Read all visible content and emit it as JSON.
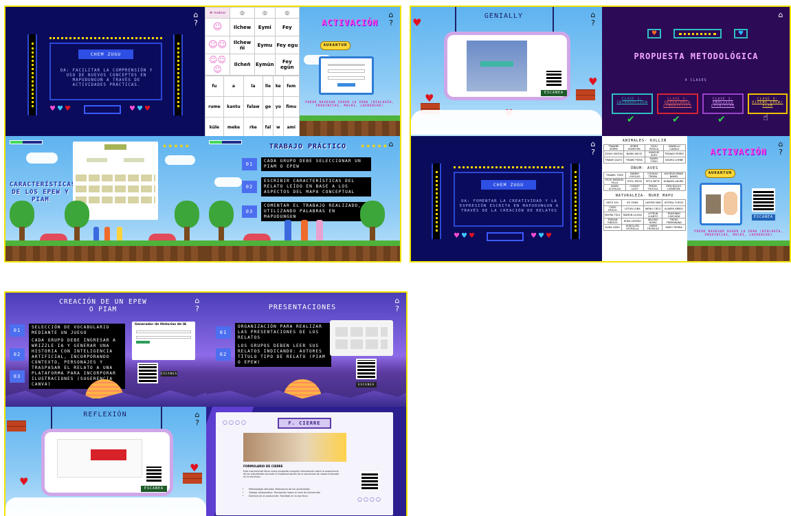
{
  "nav": {
    "home": "⌂",
    "help": "?"
  },
  "g1": {
    "s1": {
      "title": "CHEM ZUGU",
      "text": "OA: FACILITAR LA COMPRENSIÓN Y USO DE NUEVOS CONCEPTOS EN MAPUDUNGUN A TRAVÉS DE ACTIVIDADES PRÁCTICAS."
    },
    "s2": {
      "head": [
        "Ilchew",
        "Eymi",
        "Fey"
      ],
      "rows": [
        [
          "Ilchew",
          "Eymi",
          "Fey"
        ],
        [
          "Ilchew ñi",
          "Eymu",
          "Fey egu"
        ],
        [
          "Ilcheñ",
          "Eymün",
          "Fey egün"
        ]
      ],
      "words": [
        [
          "fu",
          "a",
          "la",
          "lle",
          "ke",
          "fem"
        ],
        [
          "rume",
          "kantu",
          "falaw",
          "ge",
          "yo",
          "fimu"
        ],
        [
          "küle",
          "meke",
          "rke",
          "fal",
          "w",
          "ami"
        ]
      ]
    },
    "s3": {
      "title": "ACTIVACIÓN",
      "button": "AUKANTUN",
      "caption": "PUEDE NAVEGAR SEGÚN LA ZONA (BIOLOGÍA, PROVINCIAS, MACHI, LAVDENCHE)"
    },
    "s4": {
      "title": "CARACTERÍSTICAS DE LOS EPEW Y PIAM"
    },
    "s5": {
      "title": "TRABAJO PRÁCTICO",
      "steps": [
        {
          "num": "01",
          "text": "CADA GRUPO DEBE SELECCIONAR UN PIAM O EPEW"
        },
        {
          "num": "02",
          "text": "ESCRIBIR CARACTERÍSTICAS DEL RELATO LEÍDO EN BASE A LOS ASPECTOS DEL MAPA CONCEPTUAL"
        },
        {
          "num": "03",
          "text": "COMENTAR EL TRABAJO REALIZADO, UTILIZANDO PALABRAS EN MAPUDUNGUN"
        }
      ]
    }
  },
  "g2": {
    "s1": {
      "title": "GENIALLY",
      "scan": "ESCANEA"
    },
    "s2": {
      "title": "PROPUESTA METODOLÓGICA",
      "sub": "4 CLASES",
      "classes": [
        {
          "label": "CLASE 1: INTRODUCCIÓN",
          "color": "#26c0c0"
        },
        {
          "label": "CLASE 2: REPERTORIO LINGÜÍSTICO",
          "color": "#d92332"
        },
        {
          "label": "CLASE 3: ANÁLISIS EPEW/PIAM",
          "color": "#9a43c9"
        },
        {
          "label": "CLASE 4: DISEÑO EPEW/ PIAM",
          "color": "#f2c200"
        }
      ]
    },
    "s3": {
      "sections": [
        {
          "title": "ANIMALES- KULLIÑ",
          "rows": [
            [
              "TRAWRE ZERRE",
              "ZERRE KÜMEYEN",
              "YÜGÜ PIRÜCA",
              "KAWELLU CANELU"
            ],
            [
              "ZOWO MATUN",
              "ÑARKI WECE",
              "KANCHE ZUEY",
              "TRÜNAE PERRO"
            ],
            [
              "TRAWE SALTO",
              "TRAWE PÜMA",
              "KAWEL TODO",
              "NGURU LEMBE"
            ]
          ]
        },
        {
          "title": "ÜÑUM- AVES",
          "rows": [
            [
              "TRAWEL TÜKE",
              "ÑAMKO CHUCAO",
              "CHUKAO TRAMA",
              "KULTRUN PAWA ÑAKIÑ"
            ],
            [
              "PICHI WIÑÜKEL PILLU",
              "PÜTU IPÜCE",
              "PETU ÑETE",
              "KONKEÑ LIKÜRE"
            ],
            [
              "KAKIN UCHULKA",
              "CHÜKEY LUSO",
              "PIMUN THOOLA",
              "ZEW NGULO CAÑIÑTAN"
            ]
          ]
        },
        {
          "title": "NATURALEZA- ÑUKE MAPU",
          "rows": [
            [
              "ANTÜ SOL",
              "KÜ YEWA",
              "LAFKEN MAR",
              "KÜTRAL FUEGO"
            ],
            [
              "CÜRÜ FRÜGO",
              "LÜTUN LÜNA",
              "WENU CIELO",
              "ALIWEN ÁRBOL"
            ],
            [
              "MATRA TÜLE",
              "ÑAMÜN LLUVIA",
              "LÜTRUN LLANTO",
              "TRAYÜNKO CASCADA"
            ],
            [
              "TREKAN RIÑÜGÜ",
              "RÜKA LEFEÑO",
              "WILÜMU RÜMÜ",
              "TREKO TRIMEWANA"
            ],
            [
              "KURA LÜMU",
              "KÜRÜLLEÑ ESTRELLA",
              "LIWEN TROMÜLE",
              "MAPU TIERRA"
            ]
          ]
        }
      ]
    },
    "s4": {
      "title": "CHEM ZUGU",
      "text": "OA: FOMENTAR LA CREATIVIDAD Y LA EXPRESIÓN ESCRITA EN MAPUDUNGUN A TRAVÉS DE LA CREACIÓN DE RELATOS"
    },
    "s5": {
      "title": "ACTIVACIÓN",
      "button": "AUKANTUN",
      "scan": "ESCANEA",
      "caption": "PUEDE NAVEGAR SEGÚN LA ZONA (BIOLOGÍA, PROVINCIAS, MACHI, LAVDENCHE)"
    }
  },
  "g3": {
    "s1": {
      "title": "CREACIÓN DE UN EPEW O PIAM",
      "app": "Generador de Historias de IA",
      "scan": "ESCANEA",
      "steps": [
        {
          "num": "01",
          "text": "SELECCIÓN DE VOCABULARIO MEDIANTE UN JUEGO"
        },
        {
          "num": "02",
          "text": "CADA GRUPO DEBE INGRESAR A WRIZZLE IA Y GENERAR UNA HISTORIA CON INTELIGENCIA ARTIFICIAL, INCORPORANDO CONTEXTO, PERSONAJES Y PALABRAS EN MAPUDUNGUN"
        },
        {
          "num": "03",
          "text": "TRASPASAR EL RELATO A UNA PLATAFORMA PARA INCORPORAR ILUSTRACIONES (SUGERENCIA CANVA)"
        }
      ]
    },
    "s2": {
      "title": "PRESENTACIONES",
      "scan": "ESCANEA",
      "steps": [
        {
          "num": "01",
          "text": "ORGANIZACIÓN PARA REALIZAR LAS PRESENTACIONES DE LOS RELATOS"
        },
        {
          "num": "02",
          "text": "LOS GRUPOS DEBEN LEER SUS RELATOS INDICANDO: AUTORES TÍTULO TIPO DE RELATO (PIAM O EPEW)"
        }
      ]
    },
    "s3": {
      "title": "REFLEXIÓN",
      "scan": "ESCANEA"
    },
    "s4": {
      "title": "F. CIERRE",
      "form": "FORMULARIO DE CIERRE",
      "body": "Este instrumento tiene como propósito recopilar información sobre la experiencia de los estudiantes durante la implementación de la secuencia de clases enfocada en la escritura.",
      "bullets": [
        "Metodología utilizada: Relevancia de las actividades",
        "Trabajo colaborativo: Percepción sobre el nivel de interacción",
        "Dominio de la producción: Facilidad en la escritura"
      ]
    }
  }
}
